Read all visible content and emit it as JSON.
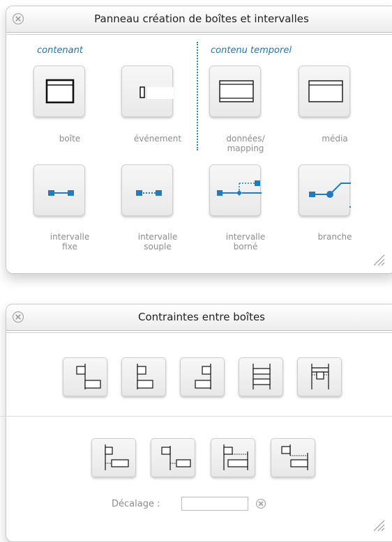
{
  "panel_creation": {
    "title": "Panneau création de boîtes et intervalles",
    "section_container": "contenant",
    "section_temporal": "contenu temporel",
    "tiles": {
      "box": "boîte",
      "event": "événement",
      "data_mapping_1": "données/",
      "data_mapping_2": "mapping",
      "media": "média",
      "fixed_interval_1": "intervalle",
      "fixed_interval_2": "fixe",
      "flexible_interval_1": "intervalle",
      "flexible_interval_2": "souple",
      "bounded_interval_1": "intervalle",
      "bounded_interval_2": "borné",
      "branch": "branche"
    }
  },
  "panel_constraints": {
    "title": "Contraintes entre boîtes",
    "offset_label": "Décalage :",
    "offset_value": ""
  },
  "colors": {
    "accent_blue": "#1a78b5",
    "icon_blue": "#1f7cc0"
  }
}
